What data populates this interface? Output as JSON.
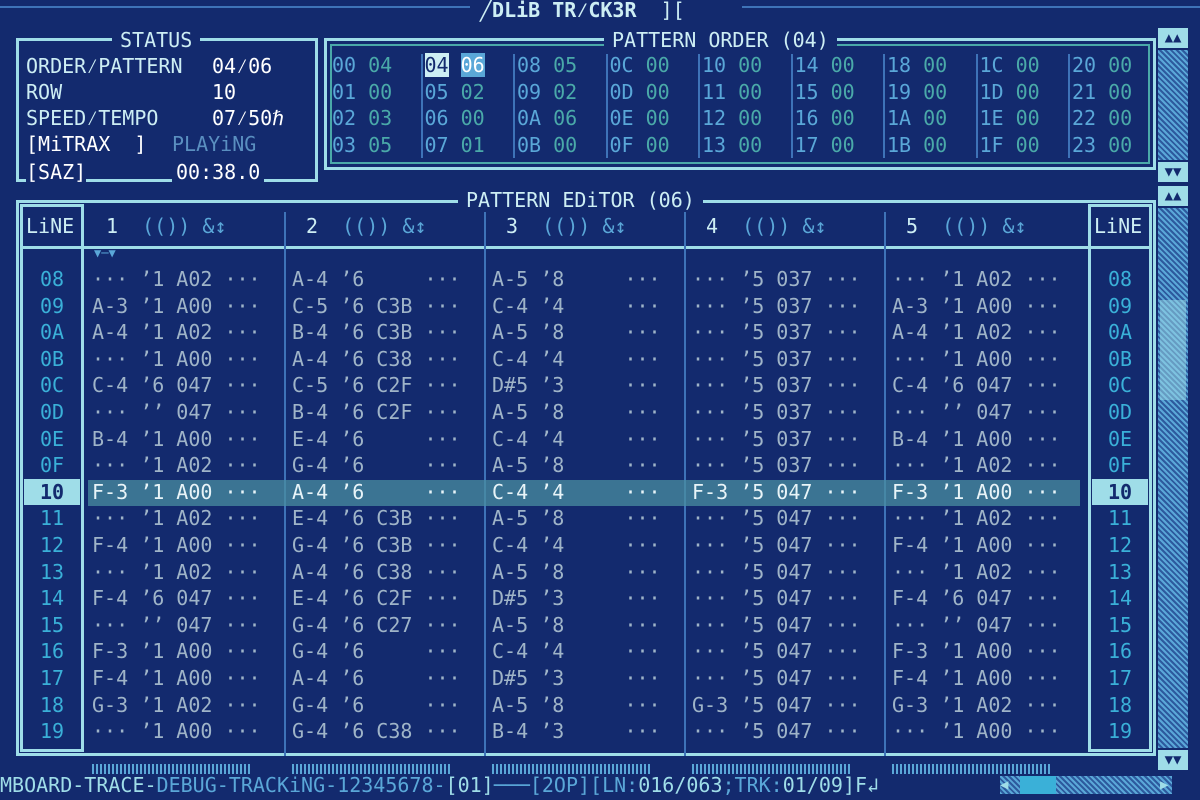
{
  "app_title": "DLiB TR⁄CK3R",
  "title_suffix": "][",
  "status": {
    "title": "STATUS",
    "rows": [
      {
        "label": "ORDER⁄PATTERN",
        "value": "04⁄06"
      },
      {
        "label": "ROW",
        "value": "10"
      },
      {
        "label": "SPEED⁄TEMPO",
        "value": "07⁄50ℏ"
      }
    ],
    "mode": "[MiTRAX  ]",
    "play_state": "PLAYiNG",
    "device": "[SAZ]",
    "time": "00:38.0"
  },
  "pattern_order": {
    "title": "PATTERN ORDER (04)",
    "columns": [
      [
        [
          "00",
          "04"
        ],
        [
          "01",
          "00"
        ],
        [
          "02",
          "03"
        ],
        [
          "03",
          "05"
        ]
      ],
      [
        [
          "04",
          "06"
        ],
        [
          "05",
          "02"
        ],
        [
          "06",
          "00"
        ],
        [
          "07",
          "01"
        ]
      ],
      [
        [
          "08",
          "05"
        ],
        [
          "09",
          "02"
        ],
        [
          "0A",
          "06"
        ],
        [
          "0B",
          "00"
        ]
      ],
      [
        [
          "0C",
          "00"
        ],
        [
          "0D",
          "00"
        ],
        [
          "0E",
          "00"
        ],
        [
          "0F",
          "00"
        ]
      ],
      [
        [
          "10",
          "00"
        ],
        [
          "11",
          "00"
        ],
        [
          "12",
          "00"
        ],
        [
          "13",
          "00"
        ]
      ],
      [
        [
          "14",
          "00"
        ],
        [
          "15",
          "00"
        ],
        [
          "16",
          "00"
        ],
        [
          "17",
          "00"
        ]
      ],
      [
        [
          "18",
          "00"
        ],
        [
          "19",
          "00"
        ],
        [
          "1A",
          "00"
        ],
        [
          "1B",
          "00"
        ]
      ],
      [
        [
          "1C",
          "00"
        ],
        [
          "1D",
          "00"
        ],
        [
          "1E",
          "00"
        ],
        [
          "1F",
          "00"
        ]
      ],
      [
        [
          "20",
          "00"
        ],
        [
          "21",
          "00"
        ],
        [
          "22",
          "00"
        ],
        [
          "23",
          "00"
        ]
      ]
    ],
    "selected": "04"
  },
  "editor": {
    "title": "PATTERN EDiTOR (06)",
    "line_header": "LiNE",
    "channel_icons": "(()) &↕",
    "channels": [
      "1",
      "2",
      "3",
      "4",
      "5"
    ],
    "lines": [
      "08",
      "09",
      "0A",
      "0B",
      "0C",
      "0D",
      "0E",
      "0F",
      "10",
      "11",
      "12",
      "13",
      "14",
      "15",
      "16",
      "17",
      "18",
      "19"
    ],
    "current_line": "10",
    "rows": [
      [
        "··· ’1 A02 ···",
        "A-4 ’6     ···",
        "A-5 ’8     ···",
        "··· ’5 037 ···",
        "··· ’1 A02 ···"
      ],
      [
        "A-3 ’1 A00 ···",
        "C-5 ’6 C3B ···",
        "C-4 ’4     ···",
        "··· ’5 037 ···",
        "A-3 ’1 A00 ···"
      ],
      [
        "A-4 ’1 A02 ···",
        "B-4 ’6 C3B ···",
        "A-5 ’8     ···",
        "··· ’5 037 ···",
        "A-4 ’1 A02 ···"
      ],
      [
        "··· ’1 A00 ···",
        "A-4 ’6 C38 ···",
        "C-4 ’4     ···",
        "··· ’5 037 ···",
        "··· ’1 A00 ···"
      ],
      [
        "C-4 ’6 047 ···",
        "C-5 ’6 C2F ···",
        "D#5 ’3     ···",
        "··· ’5 037 ···",
        "C-4 ’6 047 ···"
      ],
      [
        "··· ’’ 047 ···",
        "B-4 ’6 C2F ···",
        "A-5 ’8     ···",
        "··· ’5 037 ···",
        "··· ’’ 047 ···"
      ],
      [
        "B-4 ’1 A00 ···",
        "E-4 ’6     ···",
        "C-4 ’4     ···",
        "··· ’5 037 ···",
        "B-4 ’1 A00 ···"
      ],
      [
        "··· ’1 A02 ···",
        "G-4 ’6     ···",
        "A-5 ’8     ···",
        "··· ’5 037 ···",
        "··· ’1 A02 ···"
      ],
      [
        "F-3 ’1 A00 ···",
        "A-4 ’6     ···",
        "C-4 ’4     ···",
        "F-3 ’5 047 ···",
        "F-3 ’1 A00 ···"
      ],
      [
        "··· ’1 A02 ···",
        "E-4 ’6 C3B ···",
        "A-5 ’8     ···",
        "··· ’5 047 ···",
        "··· ’1 A02 ···"
      ],
      [
        "F-4 ’1 A00 ···",
        "G-4 ’6 C3B ···",
        "C-4 ’4     ···",
        "··· ’5 047 ···",
        "F-4 ’1 A00 ···"
      ],
      [
        "··· ’1 A02 ···",
        "A-4 ’6 C38 ···",
        "A-5 ’8     ···",
        "··· ’5 047 ···",
        "··· ’1 A02 ···"
      ],
      [
        "F-4 ’6 047 ···",
        "E-4 ’6 C2F ···",
        "D#5 ’3     ···",
        "··· ’5 047 ···",
        "F-4 ’6 047 ···"
      ],
      [
        "··· ’’ 047 ···",
        "G-4 ’6 C27 ···",
        "A-5 ’8     ···",
        "··· ’5 047 ···",
        "··· ’’ 047 ···"
      ],
      [
        "F-3 ’1 A00 ···",
        "G-4 ’6     ···",
        "C-4 ’4     ···",
        "··· ’5 047 ···",
        "F-3 ’1 A00 ···"
      ],
      [
        "F-4 ’1 A00 ···",
        "A-4 ’6     ···",
        "D#5 ’3     ···",
        "··· ’5 047 ···",
        "F-4 ’1 A00 ···"
      ],
      [
        "G-3 ’1 A02 ···",
        "G-4 ’6     ···",
        "A-5 ’8     ···",
        "G-3 ’5 047 ···",
        "G-3 ’1 A02 ···"
      ],
      [
        "··· ’1 A00 ···",
        "G-4 ’6 C38 ···",
        "B-4 ’3     ···",
        "··· ’5 047 ···",
        "··· ’1 A00 ···"
      ]
    ]
  },
  "statusbar": {
    "left_a": "MBOARD-TRACE-",
    "left_b": "DEBUG-TRACKiNG-12345678-",
    "chan": "[01]",
    "mid": "[2OP][LN:",
    "ln": "016/063",
    "trk_label": ";TRK:",
    "trk": "01/09",
    "end": "]F↲"
  },
  "colors": {
    "background": "#132a6e",
    "frame": "#9fdde8",
    "highlight": "#4a8ea0"
  }
}
